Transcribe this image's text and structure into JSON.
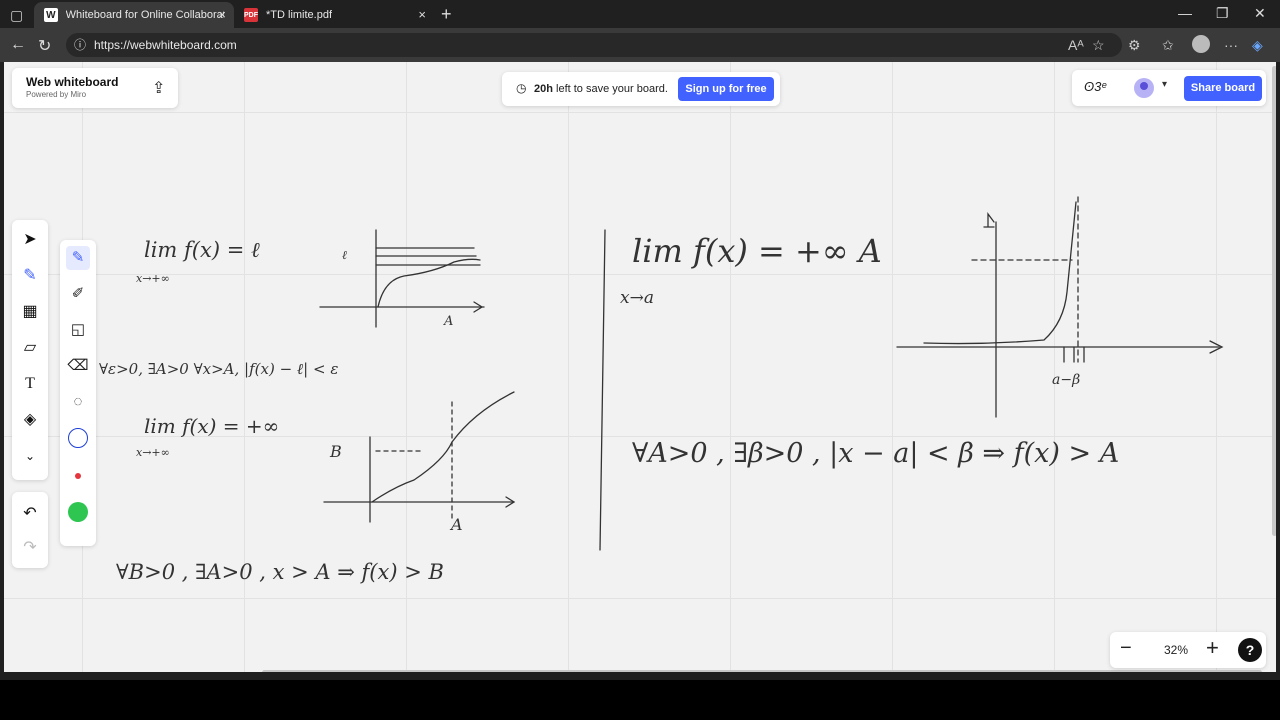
{
  "browser": {
    "tabs": [
      {
        "title": "Whiteboard for Online Collaborati",
        "favicon": "W",
        "active": true
      },
      {
        "title": "*TD limite.pdf",
        "favicon": "pdf",
        "active": false
      }
    ],
    "url": "https://webwhiteboard.com"
  },
  "app": {
    "brand_title": "Web whiteboard",
    "brand_subtitle": "Powered by Miro",
    "timer_bold": "20h",
    "timer_text": " left to save your board.",
    "signup_label": "Sign up for free",
    "share_label": "Share board",
    "zoom": "32%",
    "help": "?"
  },
  "board": {
    "handwritten": [
      "lim f(x) = ℓ",
      "x→+∞",
      "∀ε>0, ∃A>0  ∀x>A,  |f(x) − ℓ| < ε",
      "lim f(x) = +∞",
      "x→+∞",
      "∀B>0 , ∃A>0 ,  x > A  ⇒  f(x) > B",
      "lim f(x) = +∞   A",
      "x→a",
      "∀A>0 , ∃β>0 ,  |x − a| < β  ⇒  f(x) > A",
      "ℓ",
      "A",
      "B",
      "A",
      "a−β"
    ]
  },
  "colors": {
    "accent": "#4262ff",
    "red": "#e5353f",
    "green": "#2ec551"
  }
}
